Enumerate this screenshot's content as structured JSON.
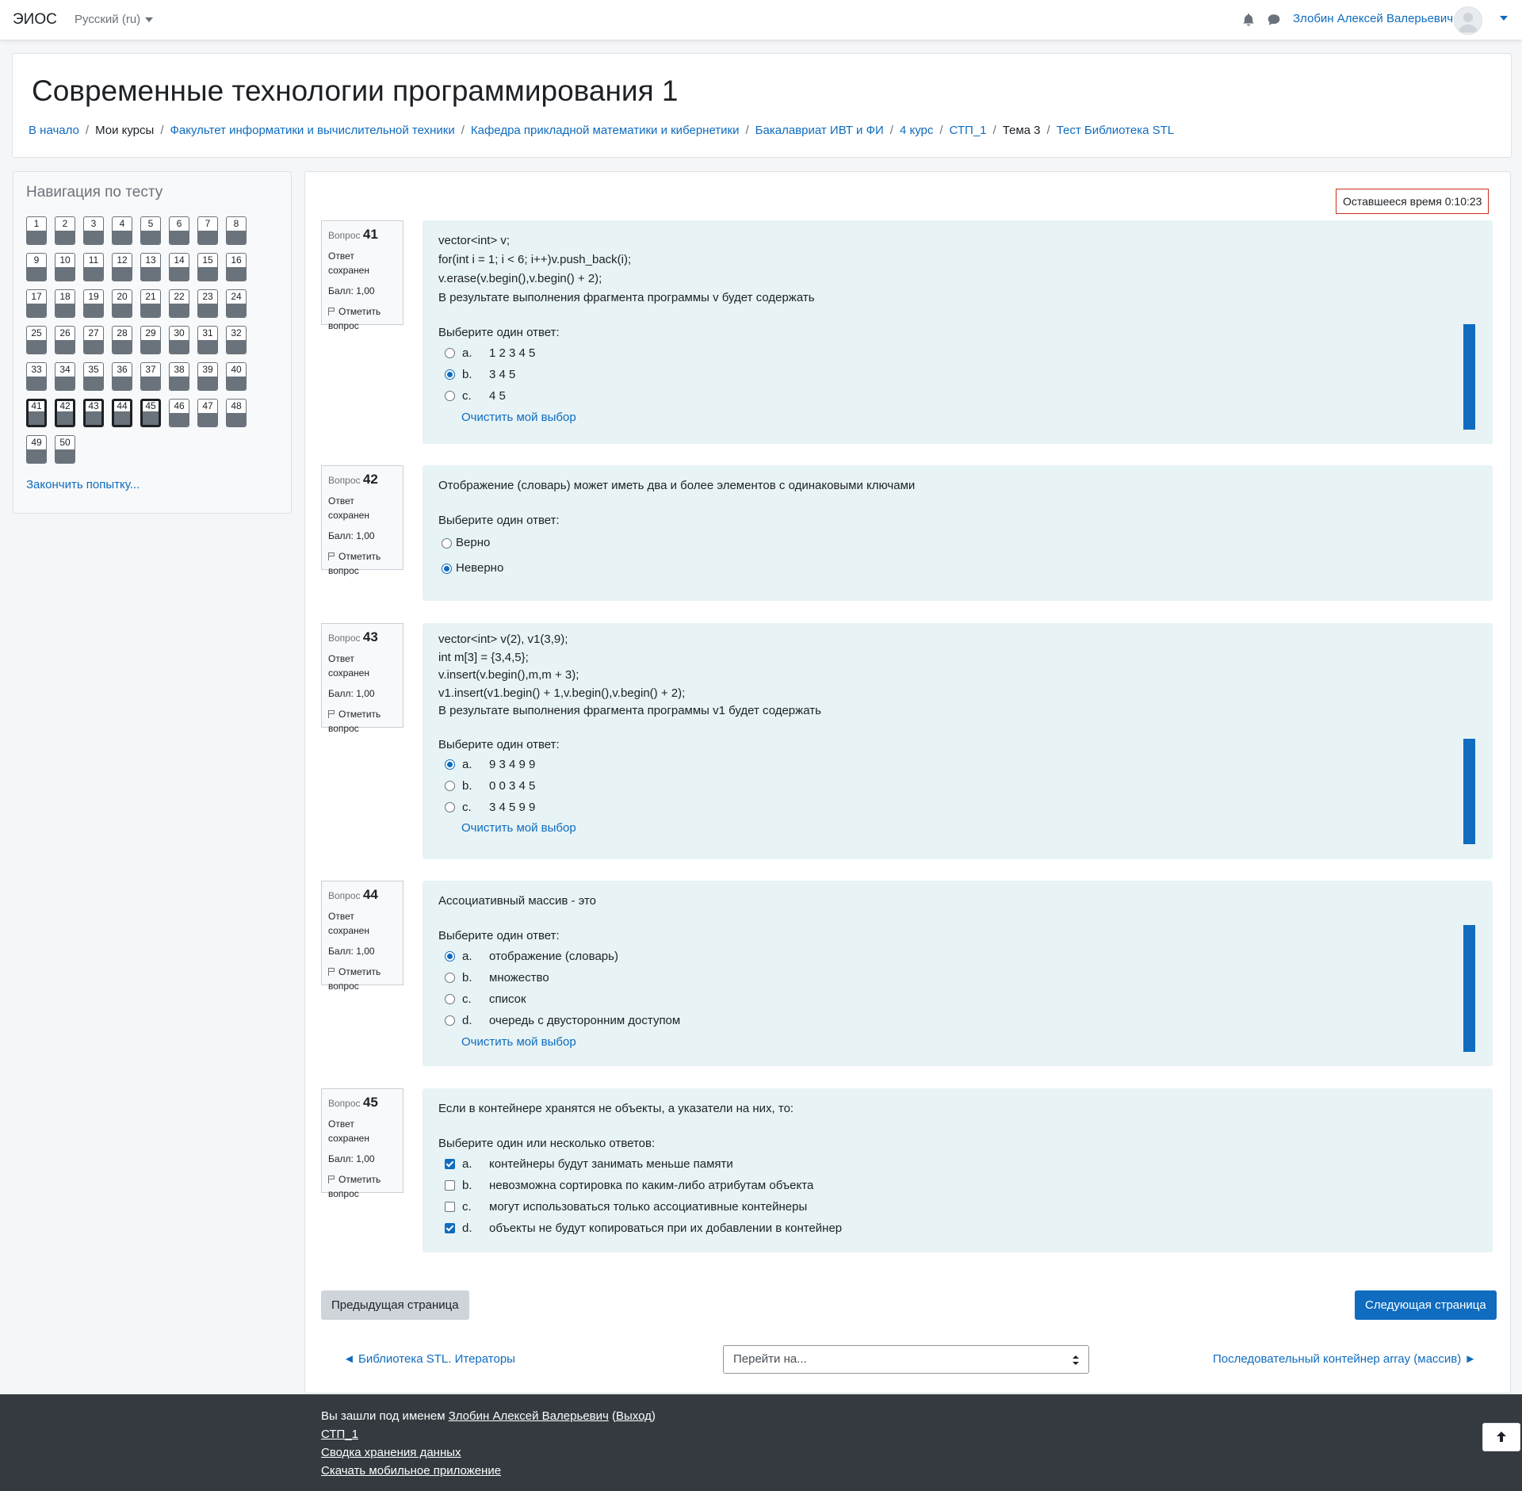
{
  "navbar": {
    "brand": "ЭИОС",
    "language": "Русский (ru)",
    "user_name": "Злобин Алексей Валерьевич"
  },
  "header": {
    "title": "Современные технологии программирования 1",
    "breadcrumb": [
      {
        "label": "В начало",
        "link": true
      },
      {
        "label": "Мои курсы",
        "link": false
      },
      {
        "label": "Факультет информатики и вычислительной техники",
        "link": true
      },
      {
        "label": "Кафедра прикладной математики и кибернетики",
        "link": true
      },
      {
        "label": "Бакалавриат ИВТ и ФИ",
        "link": true
      },
      {
        "label": "4 курс",
        "link": true
      },
      {
        "label": "СТП_1",
        "link": true
      },
      {
        "label": "Тема 3",
        "link": false
      },
      {
        "label": "Тест Библиотека STL",
        "link": true
      }
    ]
  },
  "quiz_nav": {
    "title": "Навигация по тесту",
    "questions": [
      "1",
      "2",
      "3",
      "4",
      "5",
      "6",
      "7",
      "8",
      "9",
      "10",
      "11",
      "12",
      "13",
      "14",
      "15",
      "16",
      "17",
      "18",
      "19",
      "20",
      "21",
      "22",
      "23",
      "24",
      "25",
      "26",
      "27",
      "28",
      "29",
      "30",
      "31",
      "32",
      "33",
      "34",
      "35",
      "36",
      "37",
      "38",
      "39",
      "40",
      "41",
      "42",
      "43",
      "44",
      "45",
      "46",
      "47",
      "48",
      "49",
      "50"
    ],
    "current_page": [
      "41",
      "42",
      "43",
      "44",
      "45"
    ],
    "finish_label": "Закончить попытку..."
  },
  "timer": "Оставшееся время 0:10:23",
  "question_labels": {
    "question": "Вопрос",
    "state": "Ответ сохранен",
    "mark": "Балл: 1,00",
    "flag": "Отметить вопрос",
    "clear": "Очистить мой выбор"
  },
  "questions": [
    {
      "number": "41",
      "text": [
        "vector<int> v;",
        "for(int i = 1; i < 6; i++)v.push_back(i);",
        "v.erase(v.begin(),v.begin() + 2);",
        "В результате выполнения фрагмента программы v будет содержать"
      ],
      "prompt": "Выберите один ответ:",
      "options": [
        {
          "letter": "a.",
          "text": "1 2 3 4 5",
          "selected": false
        },
        {
          "letter": "b.",
          "text": "3 4 5",
          "selected": true
        },
        {
          "letter": "c.",
          "text": "4 5",
          "selected": false
        }
      ]
    },
    {
      "number": "42",
      "text": [
        "Отображение (словарь) может иметь два и более элементов с одинаковыми ключами"
      ],
      "prompt": "Выберите один ответ:",
      "options": [
        {
          "text": "Верно",
          "selected": false
        },
        {
          "text": "Неверно",
          "selected": true
        }
      ]
    },
    {
      "number": "43",
      "text": [
        "vector<int> v(2), v1(3,9);",
        "int m[3] = {3,4,5};",
        "v.insert(v.begin(),m,m + 3);",
        "v1.insert(v1.begin() + 1,v.begin(),v.begin() + 2);",
        "В результате выполнения фрагмента программы v1 будет содержать"
      ],
      "prompt": "Выберите один ответ:",
      "options": [
        {
          "letter": "a.",
          "text": "9 3 4 9 9",
          "selected": true
        },
        {
          "letter": "b.",
          "text": "0 0 3 4 5",
          "selected": false
        },
        {
          "letter": "c.",
          "text": "3 4 5 9 9",
          "selected": false
        }
      ]
    },
    {
      "number": "44",
      "text": [
        "Ассоциативный массив - это"
      ],
      "prompt": "Выберите один ответ:",
      "options": [
        {
          "letter": "a.",
          "text": "отображение (словарь)",
          "selected": true
        },
        {
          "letter": "b.",
          "text": "множество",
          "selected": false
        },
        {
          "letter": "c.",
          "text": "список",
          "selected": false
        },
        {
          "letter": "d.",
          "text": "очередь с двусторонним доступом",
          "selected": false
        }
      ]
    },
    {
      "number": "45",
      "text": [
        "Если в контейнере хранятся не объекты, а указатели на них, то:"
      ],
      "prompt": "Выберите один или несколько ответов:",
      "options": [
        {
          "letter": "a.",
          "text": "контейнеры будут занимать меньше памяти",
          "selected": true
        },
        {
          "letter": "b.",
          "text": "невозможна сортировка по каким-либо атрибутам объекта",
          "selected": false
        },
        {
          "letter": "c.",
          "text": "могут использоваться только ассоциативные контейнеры",
          "selected": false
        },
        {
          "letter": "d.",
          "text": "объекты не будут копироваться при их добавлении в контейнер",
          "selected": true
        }
      ]
    }
  ],
  "buttons": {
    "prev_page": "Предыдущая страница",
    "next_page": "Следующая страница"
  },
  "activity_nav": {
    "prev": "◄ Библиотека STL. Итераторы",
    "jump_placeholder": "Перейти на...",
    "next": "Последовательный контейнер array (массив) ►"
  },
  "footer": {
    "logged_in_prefix": "Вы зашли под именем ",
    "user": "Злобин Алексей Валерьевич",
    "logout": "Выход",
    "course": "СТП_1",
    "data_summary": "Сводка хранения данных",
    "mobile_app": "Скачать мобильное приложение"
  },
  "colors": {
    "primary": "#0f6cbf",
    "question_bg": "#e7f3f5",
    "footer_bg": "#343a40",
    "timer_border": "#ca3120"
  }
}
